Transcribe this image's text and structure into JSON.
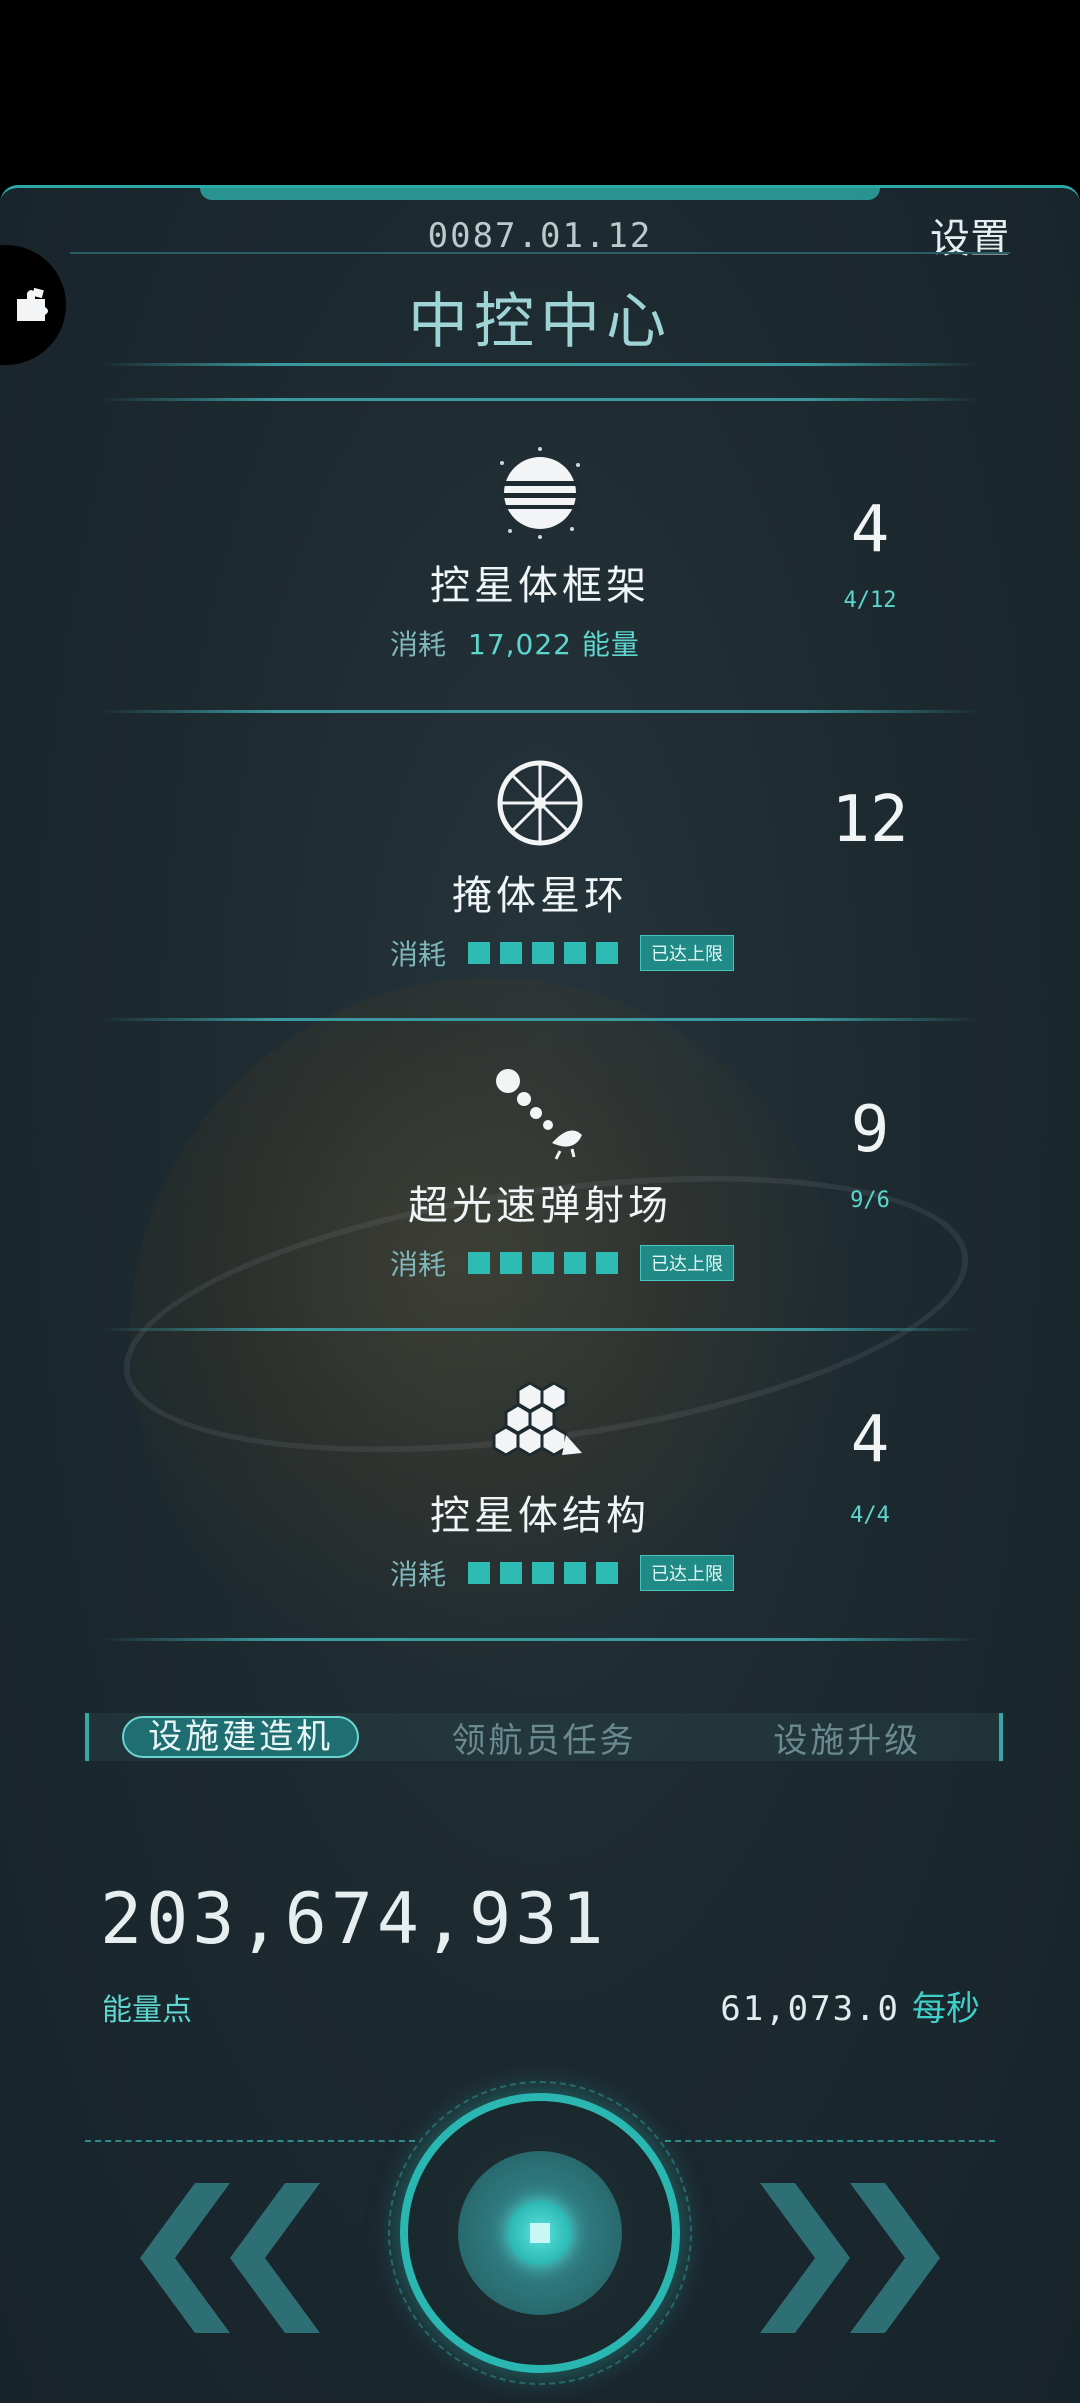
{
  "header": {
    "date": "0087.01.12",
    "settings_label": "设置",
    "title": "中控中心"
  },
  "items": [
    {
      "name": "控星体框架",
      "cost_label": "消耗",
      "cost_value": "17,022 能量",
      "level": "4",
      "progress": "4/12",
      "icon": "sphere-icon"
    },
    {
      "name": "掩体星环",
      "cost_label": "消耗",
      "maxed_label": "已达上限",
      "level": "12",
      "progress": "",
      "icon": "ring-wheel-icon"
    },
    {
      "name": "超光速弹射场",
      "cost_label": "消耗",
      "maxed_label": "已达上限",
      "level": "9",
      "progress": "9/6",
      "icon": "launcher-icon"
    },
    {
      "name": "控星体结构",
      "cost_label": "消耗",
      "maxed_label": "已达上限",
      "level": "4",
      "progress": "4/4",
      "icon": "hexagon-icon"
    }
  ],
  "tabs": [
    {
      "label": "设施建造机",
      "active": true
    },
    {
      "label": "领航员任务",
      "active": false
    },
    {
      "label": "设施升级",
      "active": false
    }
  ],
  "energy": {
    "value": "203,674,931",
    "label": "能量点",
    "rate_value": "61,073.0",
    "rate_unit": "每秒"
  },
  "colors": {
    "accent": "#2ab7b2",
    "background": "#1d2a30",
    "highlight": "#5ed6d0"
  }
}
